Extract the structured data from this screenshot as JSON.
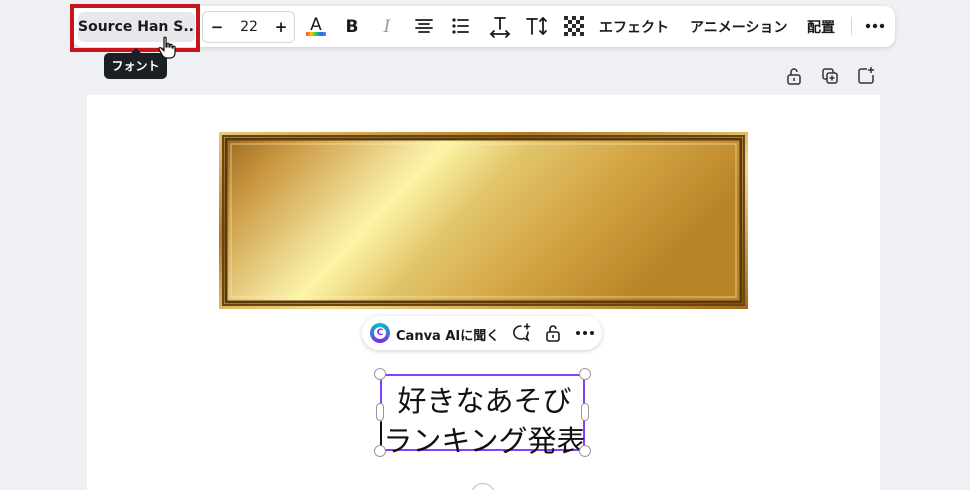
{
  "toolbar": {
    "font_name": "Source Han S...",
    "font_size": "22",
    "decrease_label": "−",
    "increase_label": "+",
    "effects_label": "エフェクト",
    "animate_label": "アニメーション",
    "position_label": "配置",
    "icons": [
      "text-color-icon",
      "bold-icon",
      "italic-icon",
      "align-center-icon",
      "list-icon",
      "letter-spacing-icon",
      "text-size-icon",
      "transparency-icon",
      "more-icon"
    ]
  },
  "tooltip": {
    "label": "フォント"
  },
  "page_actions": [
    "lock-icon",
    "duplicate-page-icon",
    "add-page-icon"
  ],
  "ai_bar": {
    "label": "Canva AIに聞く",
    "logo_letter": "C"
  },
  "text_element": {
    "line1": "好きなあそび",
    "line2": "ランキング発表"
  },
  "colors": {
    "highlight": "#c8141b",
    "selection": "#8b3dff",
    "background": "#eef0f4"
  }
}
